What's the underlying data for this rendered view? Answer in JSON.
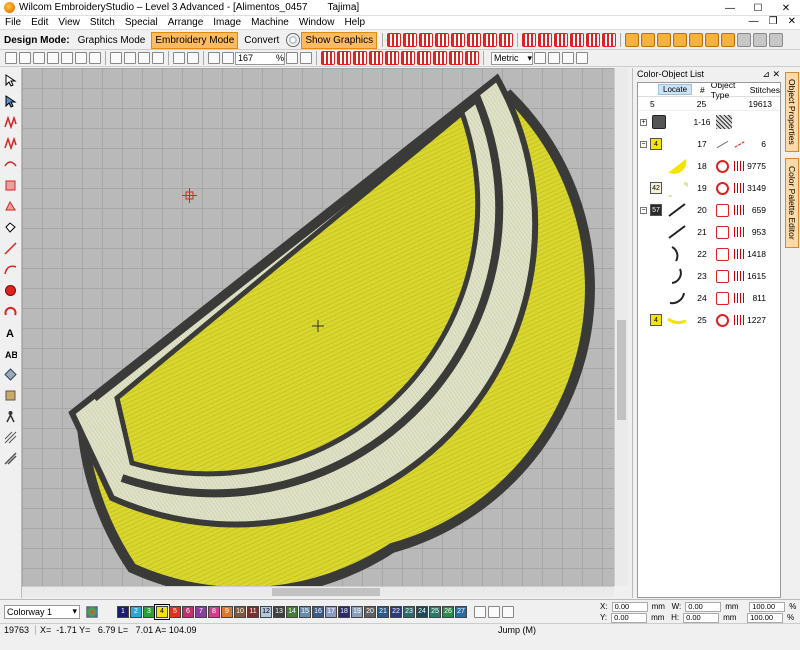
{
  "window": {
    "title": "Wilcom EmbroideryStudio – Level 3 Advanced - [Alimentos_0457",
    "title_machine": "Tajima]",
    "minimize": "—",
    "maximize": "☐",
    "close": "✕"
  },
  "menu": {
    "items": [
      "File",
      "Edit",
      "View",
      "Stitch",
      "Special",
      "Arrange",
      "Image",
      "Machine",
      "Window",
      "Help"
    ],
    "mdi_min": "—",
    "mdi_restore": "❐",
    "mdi_close": "✕"
  },
  "toolbar1": {
    "design_mode_label": "Design Mode:",
    "graphics_mode": "Graphics Mode",
    "embroidery_mode": "Embroidery Mode",
    "convert": "Convert",
    "show_graphics": "Show Graphics"
  },
  "toolbar2": {
    "zoom_value": "167",
    "zoom_suffix": "%",
    "units": "Metric"
  },
  "panel": {
    "title": "Color-Object List",
    "pin": "⊿ ✕",
    "locate": "Locate",
    "col_num": "#",
    "col_type": "Object Type",
    "col_stitches": "Stitches",
    "summary": {
      "colors": "5",
      "objects": "25",
      "stitches": "19613"
    },
    "rows": [
      {
        "num": "1-16",
        "swatch": "",
        "stitches": ""
      },
      {
        "num": "17",
        "swatch": "4",
        "stitches": "6"
      },
      {
        "num": "18",
        "swatch": "",
        "stitches": "9775"
      },
      {
        "num": "19",
        "swatch": "42",
        "stitches": "3149"
      },
      {
        "num": "20",
        "swatch": "57",
        "stitches": "659"
      },
      {
        "num": "21",
        "swatch": "",
        "stitches": "953"
      },
      {
        "num": "22",
        "swatch": "",
        "stitches": "1418"
      },
      {
        "num": "23",
        "swatch": "",
        "stitches": "1615"
      },
      {
        "num": "24",
        "swatch": "",
        "stitches": "811"
      },
      {
        "num": "25",
        "swatch": "4",
        "stitches": "1227"
      }
    ]
  },
  "side_tabs": {
    "object_properties": "Object Properties",
    "color_palette_editor": "Color Palette Editor"
  },
  "colorbar": {
    "colorway": "Colorway 1",
    "chips": [
      {
        "label": "1",
        "color": "#1c1c6e"
      },
      {
        "label": "2",
        "color": "#2aa8d8"
      },
      {
        "label": "3",
        "color": "#2e9e3a"
      },
      {
        "label": "4",
        "color": "#f5e400"
      },
      {
        "label": "5",
        "color": "#e0301e"
      },
      {
        "label": "6",
        "color": "#c0306a"
      },
      {
        "label": "7",
        "color": "#8a3fa0"
      },
      {
        "label": "8",
        "color": "#d23c8a"
      },
      {
        "label": "9",
        "color": "#d87a2a"
      },
      {
        "label": "10",
        "color": "#7d5a3c"
      },
      {
        "label": "11",
        "color": "#7a3030"
      },
      {
        "label": "12",
        "color": "#b0c8e0"
      },
      {
        "label": "13",
        "color": "#404040"
      },
      {
        "label": "14",
        "color": "#4a7a3a"
      },
      {
        "label": "15",
        "color": "#6a8aa8"
      },
      {
        "label": "16",
        "color": "#3a5a8a"
      },
      {
        "label": "17",
        "color": "#8a9ac0"
      },
      {
        "label": "18",
        "color": "#2a2a6a"
      },
      {
        "label": "19",
        "color": "#8aa0b8"
      },
      {
        "label": "20",
        "color": "#606060"
      },
      {
        "label": "21",
        "color": "#2a5a8a"
      },
      {
        "label": "22",
        "color": "#2a3a7a"
      },
      {
        "label": "23",
        "color": "#2a6a6a"
      },
      {
        "label": "24",
        "color": "#1a4a5a"
      },
      {
        "label": "25",
        "color": "#2a7a6a"
      },
      {
        "label": "26",
        "color": "#2a8a4a"
      },
      {
        "label": "27",
        "color": "#2a6aa0"
      }
    ],
    "selected_chip": "4",
    "coords": {
      "x_label": "X:",
      "x_value": "0.00",
      "x_unit": "mm",
      "y_label": "Y:",
      "y_value": "0.00",
      "y_unit": "mm",
      "w_label": "W:",
      "w_value": "0.00",
      "w_unit": "mm",
      "w_pct": "100.00",
      "w_pct_unit": "%",
      "h_label": "H:",
      "h_value": "0.00",
      "h_unit": "mm",
      "h_pct": "100.00",
      "h_pct_unit": "%"
    }
  },
  "status": {
    "stitch_count": "19763",
    "coords": "X=  -1.71 Y=   6.79 L=   7.01 A= 104.09",
    "action": "Jump (M)"
  },
  "design": {
    "yellow": "#d9d62e",
    "cream": "#dfe2c6",
    "outline": "#3a3a38"
  }
}
